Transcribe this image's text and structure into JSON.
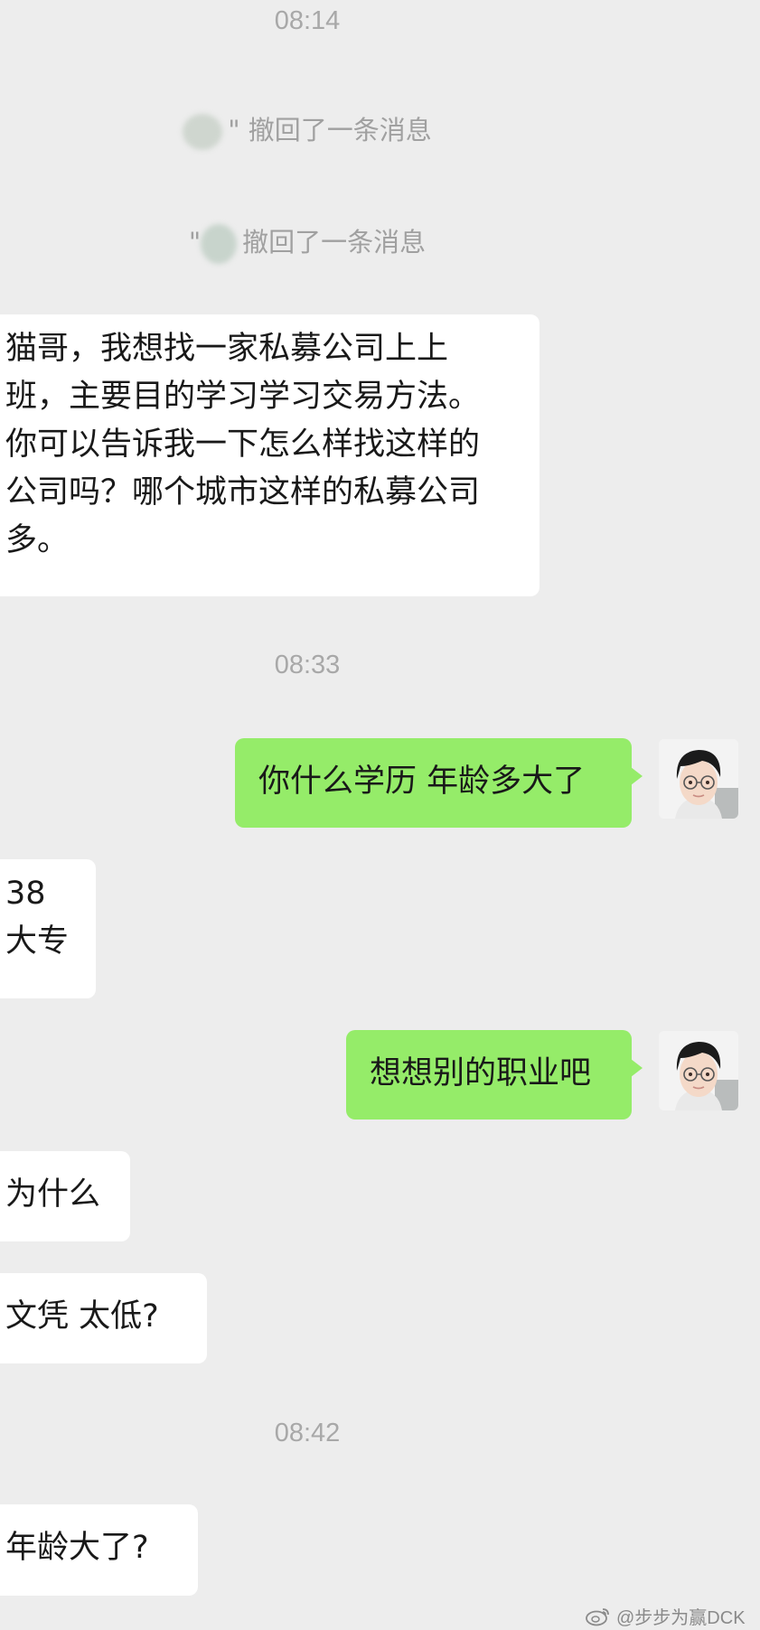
{
  "timestamps": [
    "08:14",
    "08:33",
    "08:42"
  ],
  "recalls": [
    {
      "prefix": "\"",
      "text": "撤回了一条消息"
    },
    {
      "prefix": "\"",
      "text": "撤回了一条消息"
    }
  ],
  "messages": [
    {
      "side": "in",
      "text": "猫哥，我想找一家私募公司上上\n班，主要目的学习学习交易方法。\n你可以告诉我一下怎么样找这样的\n公司吗？哪个城市这样的私募公司\n多。"
    },
    {
      "side": "out",
      "text": "你什么学历 年龄多大了"
    },
    {
      "side": "in",
      "text": "38\n大专"
    },
    {
      "side": "out",
      "text": "想想别的职业吧"
    },
    {
      "side": "in",
      "text": "为什么"
    },
    {
      "side": "in",
      "text": "文凭 太低?"
    },
    {
      "side": "in",
      "text": "年龄大了?"
    }
  ],
  "watermark": {
    "text": "@步步为赢DCK",
    "icon": "weibo-icon"
  },
  "colors": {
    "background": "#ededed",
    "outgoing_bubble": "#95ec69",
    "incoming_bubble": "#ffffff"
  }
}
